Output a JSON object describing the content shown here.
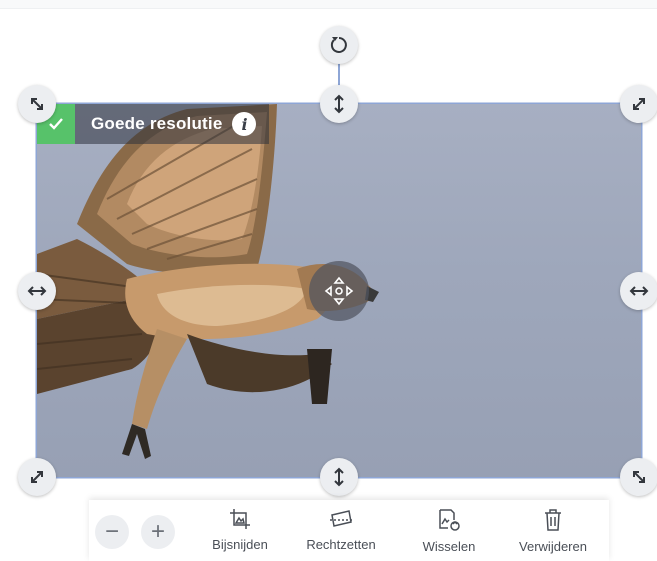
{
  "badge": {
    "status": "good",
    "text": "Goede resolutie",
    "info_glyph": "i",
    "check_color": "#57c26a"
  },
  "handles": {
    "rotate": "rotate-icon",
    "move": "move-icon"
  },
  "zoom": {
    "minus_glyph": "−",
    "plus_glyph": "+"
  },
  "toolbar": {
    "crop_label": "Bijsnijden",
    "straighten_label": "Rechtzetten",
    "swap_label": "Wisselen",
    "delete_label": "Verwijderen"
  },
  "colors": {
    "selection": "#8ea6d6",
    "handle_bg": "#eceef1",
    "photo_sky": "#a2aabd"
  }
}
